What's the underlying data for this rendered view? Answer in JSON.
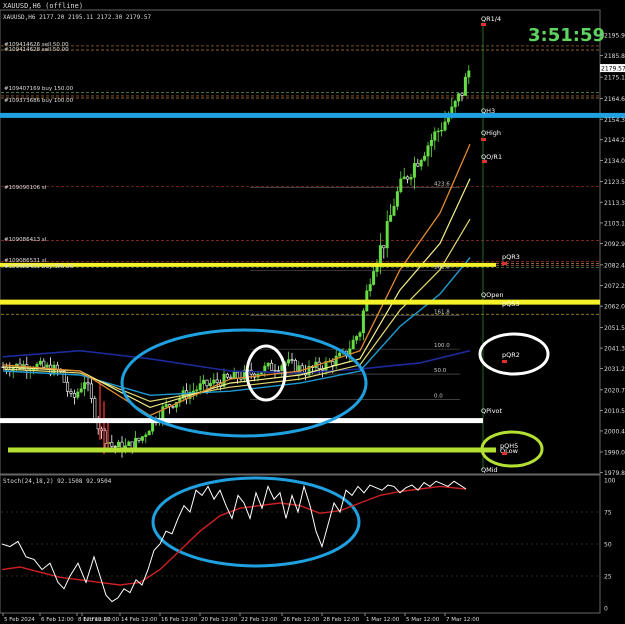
{
  "window": {
    "title": "XAUUSD,H6 (offline)"
  },
  "main_panel": {
    "header": "XAUUSD,H6  2177.20 2195.11 2172.30 2179.57",
    "countdown": "3:51:59",
    "current_price_tag": "2179.57",
    "price_axis_labels": [
      "2195.90",
      "2185.80",
      "2175.10",
      "2164.60",
      "2154.30",
      "2144.20",
      "2134.00",
      "2123.50",
      "2113.30",
      "2103.10",
      "2092.90",
      "2082.40",
      "2072.20",
      "2062.00",
      "2051.50",
      "2041.30",
      "2031.20",
      "2020.70",
      "2010.50",
      "2000.40",
      "1990.00",
      "1979.80"
    ],
    "trade_labels": [
      "#109414626 sell 50.00",
      "#109414628 sell 50.00",
      "#109407169 buy 150.00",
      "#109373686 buy 100.00",
      "#109090106 sl",
      "#109086413 sl",
      "#109086531 sl",
      "#109088431 buy 300.00"
    ],
    "pivot_labels": [
      "QR1/4",
      "QH3",
      "QHigh",
      "QO/R1",
      "pQR3",
      "QOpen",
      "pQR2",
      "QPivot",
      "pQH5",
      "QLow",
      "QMid",
      "pQS3"
    ],
    "fib_labels": [
      "423.6",
      "261.8",
      "161.8",
      "100.0",
      "50.0",
      "0.0"
    ],
    "highlight_colors": {
      "blue_level": "#1fa0e0",
      "yellow_level": "#f5f22a",
      "white_level": "#ffffff",
      "green_level": "#b4e033"
    }
  },
  "stoch_panel": {
    "header": "Stoch(24,18,2) 92.1508 92.9504",
    "axis_labels": [
      "100",
      "75",
      "50",
      "25",
      "0"
    ]
  },
  "time_axis": {
    "labels": [
      "5 Feb 2024",
      "6 Feb 12:00",
      "8 Feb 12:00",
      "12 Feb 12:00",
      "14 Feb 12:00",
      "16 Feb 12:00",
      "20 Feb 12:00",
      "22 Feb 12:00",
      "26 Feb 12:00",
      "28 Feb 12:00",
      "1 Mar 12:00",
      "5 Mar 12:00",
      "7 Mar 12:00"
    ]
  },
  "chart_data": [
    {
      "type": "line",
      "title": "XAUUSD,H6",
      "ylim": [
        1975,
        2200
      ],
      "grid": false,
      "x": [
        "5 Feb 2024",
        "6 Feb 12:00",
        "8 Feb 12:00",
        "12 Feb 12:00",
        "14 Feb 12:00",
        "16 Feb 12:00",
        "20 Feb 12:00",
        "22 Feb 12:00",
        "26 Feb 12:00",
        "28 Feb 12:00",
        "1 Mar 12:00",
        "5 Mar 12:00",
        "7 Mar 12:00"
      ],
      "series": [
        {
          "values": [
            2032,
            2030,
            2028,
            1995,
            2008,
            2015,
            2022,
            2030,
            2032,
            2044,
            2082,
            2130,
            2180
          ]
        }
      ]
    },
    {
      "type": "line",
      "title": "Stoch(24,18,2)",
      "ylim": [
        0,
        100
      ],
      "x": [
        "5 Feb 2024",
        "6 Feb 12:00",
        "8 Feb 12:00",
        "12 Feb 12:00",
        "14 Feb 12:00",
        "16 Feb 12:00",
        "20 Feb 12:00",
        "22 Feb 12:00",
        "26 Feb 12:00",
        "28 Feb 12:00",
        "1 Mar 12:00",
        "5 Mar 12:00",
        "7 Mar 12:00"
      ],
      "series": [
        {
          "values": [
            45,
            30,
            40,
            10,
            15,
            55,
            90,
            75,
            85,
            55,
            90,
            95,
            92
          ]
        },
        {
          "values": [
            28,
            22,
            25,
            20,
            18,
            30,
            55,
            70,
            78,
            72,
            85,
            93,
            93
          ]
        }
      ]
    }
  ]
}
